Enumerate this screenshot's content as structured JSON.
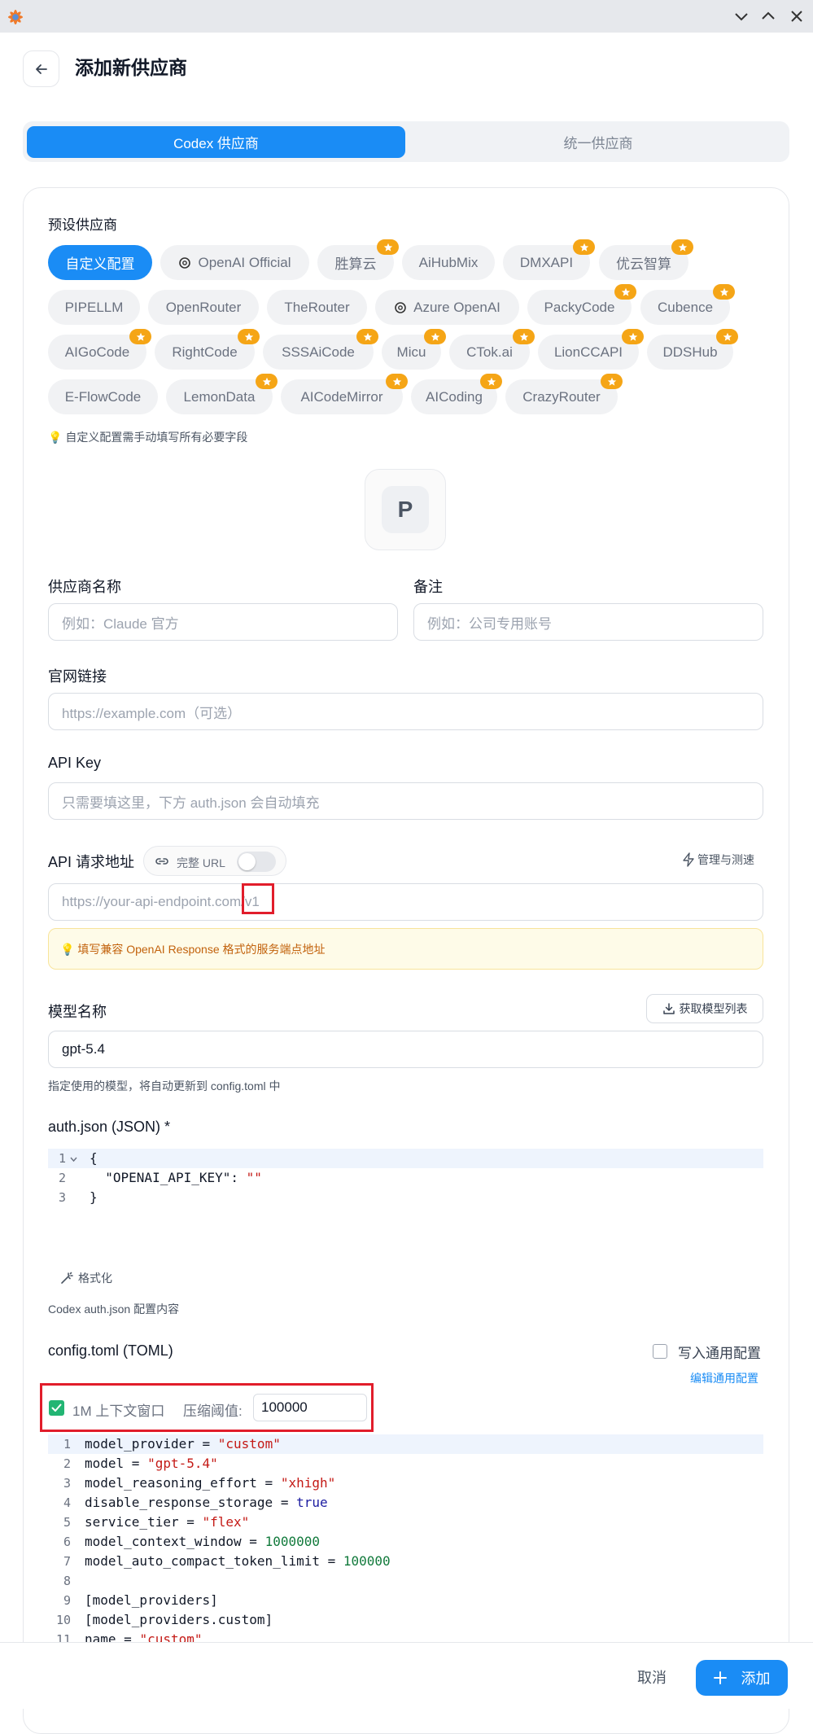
{
  "page_title": "添加新供应商",
  "tabs": [
    "Codex 供应商",
    "统一供应商"
  ],
  "preset": {
    "title": "预设供应商",
    "chips": [
      "自定义配置",
      "OpenAI Official",
      "胜算云",
      "AiHubMix",
      "DMXAPI",
      "优云智算",
      "PIPELLM",
      "OpenRouter",
      "TheRouter",
      "Azure OpenAI",
      "PackyCode",
      "Cubence",
      "AIGoCode",
      "RightCode",
      "SSSAiCode",
      "Micu",
      "CTok.ai",
      "LionCCAPI",
      "DDSHub",
      "E-FlowCode",
      "LemonData",
      "AICodeMirror",
      "AICoding",
      "CrazyRouter"
    ],
    "hint": "💡 自定义配置需手动填写所有必要字段"
  },
  "icon_letter": "P",
  "form": {
    "name_label": "供应商名称",
    "name_placeholder": "例如：Claude 官方",
    "notes_label": "备注",
    "notes_placeholder": "例如：公司专用账号",
    "website_label": "官网链接",
    "website_placeholder": "https://example.com（可选）",
    "apikey_label": "API Key",
    "apikey_placeholder": "只需要填这里，下方 auth.json 会自动填充",
    "endpoint_label": "API 请求地址",
    "full_url_label": "完整 URL",
    "manage_label": "管理与测速",
    "endpoint_placeholder": "https://your-api-endpoint.com/v1",
    "endpoint_warning": "💡 填写兼容 OpenAI Response 格式的服务端点地址",
    "model_label": "模型名称",
    "fetch_models_label": "获取模型列表",
    "model_value": "gpt-5.4",
    "model_hint": "指定使用的模型，将自动更新到 config.toml 中",
    "auth_label": "auth.json (JSON) *",
    "format_label": "格式化",
    "auth_hint": "Codex auth.json 配置内容",
    "config_label": "config.toml (TOML)",
    "write_common_label": "写入通用配置",
    "edit_common_label": "编辑通用配置",
    "context_window_label": "1M 上下文窗口",
    "compact_threshold_label": "压缩阈值:",
    "compact_threshold_value": "100000"
  },
  "auth_code": [
    "{",
    "  \"OPENAI_API_KEY\": \"\"",
    "}"
  ],
  "toml_code": [
    "model_provider = \"custom\"",
    "model = \"gpt-5.4\"",
    "model_reasoning_effort = \"xhigh\"",
    "disable_response_storage = true",
    "service_tier = \"flex\"",
    "model_context_window = 1000000",
    "model_auto_compact_token_limit = 100000",
    "",
    "[model_providers]",
    "[model_providers.custom]",
    "name = \"custom\""
  ],
  "footer": {
    "cancel": "取消",
    "add": "添加"
  },
  "colors": {
    "accent": "#1a8cf5",
    "star_badge": "#f5a516",
    "highlight": "#e11d2b",
    "checkbox_checked": "#22b573"
  }
}
